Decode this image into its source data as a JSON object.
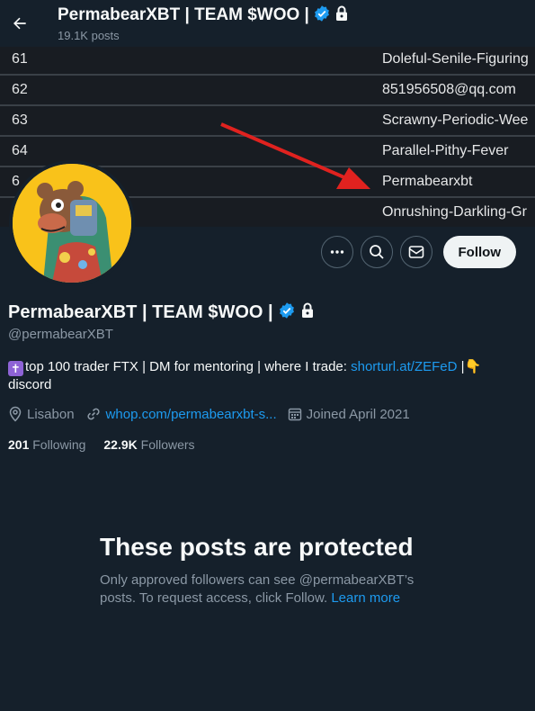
{
  "header": {
    "display_name": "PermabearXBT | TEAM $WOO |",
    "posts_count": "19.1K posts"
  },
  "banner": {
    "rows": [
      {
        "num": "61",
        "value": "Doleful-Senile-Figuring"
      },
      {
        "num": "62",
        "value": "851956508@qq.com"
      },
      {
        "num": "63",
        "value": "Scrawny-Periodic-Wee"
      },
      {
        "num": "64",
        "value": "Parallel-Pithy-Fever"
      },
      {
        "num": "6",
        "value": "Permabearxbt"
      },
      {
        "num": "",
        "value": "Onrushing-Darkling-Gr"
      }
    ],
    "arrow_color": "#e0221f"
  },
  "actions": {
    "follow_label": "Follow"
  },
  "profile": {
    "display_name": "PermabearXBT | TEAM $WOO |",
    "handle": "@permabearXBT",
    "bio_text": "top 100 trader FTX | DM for mentoring | where I trade: ",
    "bio_link": "shorturl.at/ZEFeD",
    "bio_sep": " |",
    "bio_end": "discord",
    "location": "Lisabon",
    "website": "whop.com/permabearxbt-s...",
    "joined": "Joined April 2021",
    "following_count": "201",
    "following_label": "Following",
    "followers_count": "22.9K",
    "followers_label": "Followers"
  },
  "protected": {
    "title": "These posts are protected",
    "description": "Only approved followers can see @permabearXBT’s posts. To request access, click Follow. ",
    "learn_more": "Learn more"
  },
  "colors": {
    "background": "#15202b",
    "accent": "#1d9bf0",
    "verified": "#1d9bf0",
    "avatar_bg": "#f9c21a"
  }
}
